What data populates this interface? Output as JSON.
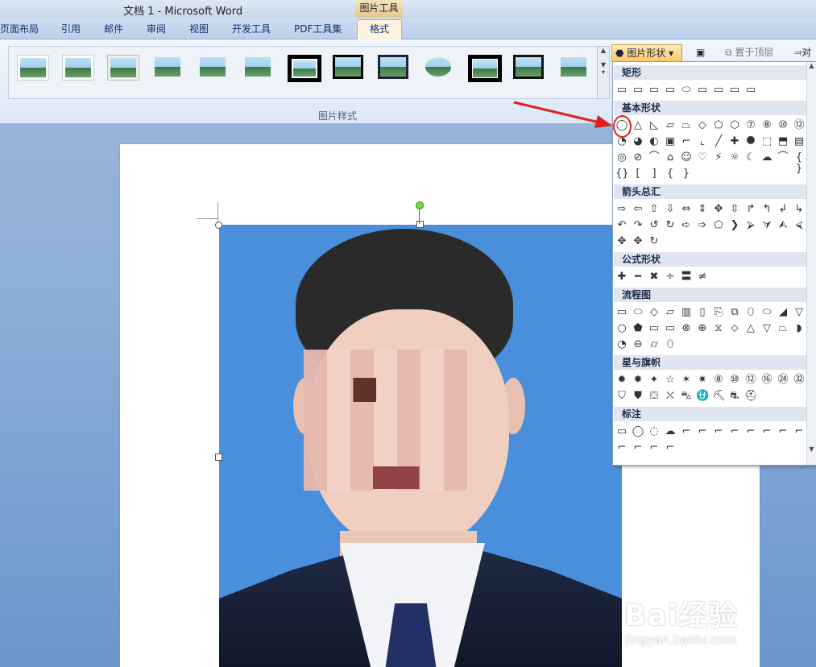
{
  "window": {
    "title": "文档 1 - Microsoft Word",
    "context_tab": "图片工具"
  },
  "tabs": [
    {
      "label": "页面布局"
    },
    {
      "label": "引用"
    },
    {
      "label": "邮件"
    },
    {
      "label": "审阅"
    },
    {
      "label": "视图"
    },
    {
      "label": "开发工具"
    },
    {
      "label": "PDF工具集"
    },
    {
      "label": "格式"
    }
  ],
  "ribbon": {
    "group_label": "图片样式",
    "shape_button": "图片形状",
    "send_front": "置于顶层",
    "align": "对"
  },
  "dropdown": {
    "categories": [
      {
        "label": "矩形"
      },
      {
        "label": "基本形状"
      },
      {
        "label": "箭头总汇"
      },
      {
        "label": "公式形状"
      },
      {
        "label": "流程图"
      },
      {
        "label": "星与旗帜"
      },
      {
        "label": "标注"
      }
    ],
    "rect_shapes": [
      "▭",
      "▭",
      "▭",
      "▭",
      "⬭",
      "▭",
      "▭",
      "▭",
      "▭"
    ],
    "basic_shapes_r1": [
      "◯",
      "△",
      "◺",
      "▱",
      "⏢",
      "◇",
      "⬠",
      "⬡",
      "⑦",
      "⑧",
      "⑩",
      "⑫"
    ],
    "basic_shapes_r2": [
      "◔",
      "◕",
      "◐",
      "▣",
      "⌐",
      "⌞",
      "╱",
      "✚",
      "⯃",
      "⬚",
      "⬒",
      "▤"
    ],
    "basic_shapes_r3": [
      "◎",
      "⊘",
      "⌒",
      "⌂",
      "☺",
      "♡",
      "⚡",
      "☼",
      "☾",
      "☁",
      "⌒",
      "{ }"
    ],
    "basic_shapes_r4": [
      "{}",
      "[",
      "]",
      "{",
      "}"
    ],
    "arrows_r1": [
      "⇨",
      "⇦",
      "⇧",
      "⇩",
      "⇔",
      "⇕",
      "✥",
      "⇳",
      "↱",
      "↰",
      "↲",
      "↳"
    ],
    "arrows_r2": [
      "↶",
      "↷",
      "↺",
      "↻",
      "➪",
      "➩",
      "⬠",
      "❯",
      "⮚",
      "⮛",
      "⮙",
      "⮘"
    ],
    "arrows_r3": [
      "✥",
      "✥",
      "↻"
    ],
    "formula": [
      "✚",
      "━",
      "✖",
      "÷",
      "〓",
      "≠"
    ],
    "flow_r1": [
      "▭",
      "⬭",
      "◇",
      "▱",
      "▥",
      "▯",
      "⎘",
      "⧉",
      "⬯",
      "⬭",
      "◢",
      "▽"
    ],
    "flow_r2": [
      "○",
      "⬟",
      "▭",
      "▭",
      "⊗",
      "⊕",
      "⧖",
      "⬦",
      "△",
      "▽",
      "⏢",
      "◗"
    ],
    "flow_r3": [
      "◔",
      "⊖",
      "⌭",
      "⬯"
    ],
    "stars_r1": [
      "✹",
      "✸",
      "✦",
      "☆",
      "✶",
      "✷",
      "⑧",
      "⑩",
      "⑫",
      "⑯",
      "㉔",
      "㉜"
    ],
    "stars_r2": [
      "⛉",
      "⛊",
      "⛋",
      "⛌",
      "⛍",
      "⛎",
      "⛏",
      "⛐",
      "⛑"
    ],
    "callouts_r1": [
      "▭",
      "◯",
      "◌",
      "☁",
      "⌐",
      "⌐",
      "⌐",
      "⌐",
      "⌐",
      "⌐",
      "⌐",
      "⌐"
    ],
    "callouts_r2": [
      "⌐",
      "⌐",
      "⌐",
      "⌐"
    ]
  },
  "watermark": {
    "brand": "Bai经验",
    "url": "jingyan.baidu.com"
  },
  "colors": {
    "accent": "#e02020",
    "selected_tab": "#fff3e0",
    "photo_bg": "#4a8fdc"
  }
}
